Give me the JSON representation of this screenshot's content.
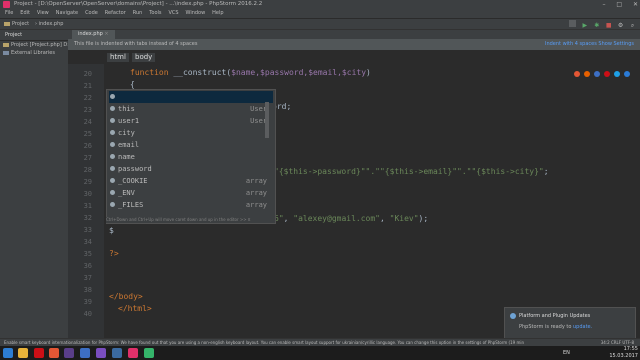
{
  "window": {
    "title": "Project - [D:\\OpenServer\\OpenServer\\domains\\Project] - ...\\index.php - PhpStorm 2016.2.2",
    "controls": [
      "–",
      "□",
      "✕"
    ]
  },
  "menu": [
    "File",
    "Edit",
    "View",
    "Navigate",
    "Code",
    "Refactor",
    "Run",
    "Tools",
    "VCS",
    "Window",
    "Help"
  ],
  "nav": {
    "project": "Project",
    "file": "index.php"
  },
  "sidebar": {
    "header": "Project",
    "items": [
      {
        "label": "Project [Project.php]  D:\\OpenServer\\Op"
      },
      {
        "label": "External Libraries"
      }
    ]
  },
  "editor_tab": {
    "label": "index.php"
  },
  "infobar": {
    "message": "This file is indented with tabs instead of 4 spaces",
    "links": "Indent with 4 spaces  Show Settings"
  },
  "tag_crumbs": [
    "html",
    "body"
  ],
  "gutter_lines": [
    "20",
    "21",
    "22",
    "23",
    "24",
    "25",
    "26",
    "27",
    "28",
    "29",
    "30",
    "31",
    "32",
    "33",
    "34",
    "35",
    "36",
    "37",
    "38",
    "39",
    "40"
  ],
  "code": {
    "l20_kw": "function",
    "l20_name": " __construct(",
    "l20_args": "$name,$password,$email,$city",
    "l20_end": ")",
    "l21": "{",
    "l24_tail": "ord;",
    "l29_a": "\"{$this->password}\"",
    "l29_b": "\".\"",
    "l29_c": "\"{$this->email}\"",
    "l29_d": "\".\"",
    "l29_e": "\"{$this->city}\"",
    "l29_f": ";",
    "l33_a": "6\"",
    "l33_b": ", ",
    "l33_c": "\"alexey@gmail.com\"",
    "l33_d": ", ",
    "l33_e": "\"Kiev\"",
    "l33_f": ");",
    "l34": "$",
    "l36": "?>",
    "l38": "</body>",
    "l39": "</html>"
  },
  "completion": {
    "items": [
      {
        "name": "",
        "type": ""
      },
      {
        "name": "this",
        "type": "User"
      },
      {
        "name": "user1",
        "type": "User"
      },
      {
        "name": "city",
        "type": ""
      },
      {
        "name": "email",
        "type": ""
      },
      {
        "name": "name",
        "type": ""
      },
      {
        "name": "password",
        "type": ""
      },
      {
        "name": "_COOKIE",
        "type": "array"
      },
      {
        "name": "_ENV",
        "type": "array"
      },
      {
        "name": "_FILES",
        "type": "array"
      }
    ],
    "hint": "Ctrl+Down and Ctrl+Up will move caret down and up in the editor  >>  π"
  },
  "notification": {
    "title": "Platform and Plugin Updates",
    "text": "PhpStorm is ready to ",
    "link": "update."
  },
  "status": {
    "message": "Enable smart keyboard internationalization for PhpStorm: We have found out that you are using a non-english keyboard layout. You can enable smart layout support for ukrainian/cyrillic language. You can change this option in the settings of PhpStorm (19 minutes ago)",
    "position": "34:2  CRLF  UTF-8"
  },
  "tray": {
    "lang": "EN",
    "time": "17:55",
    "date": "15.03.2017"
  },
  "colors": {
    "accent": "#589df6",
    "selection": "#0d293e",
    "keyword": "#cc7832",
    "variable": "#9876aa",
    "string": "#6a8759"
  }
}
